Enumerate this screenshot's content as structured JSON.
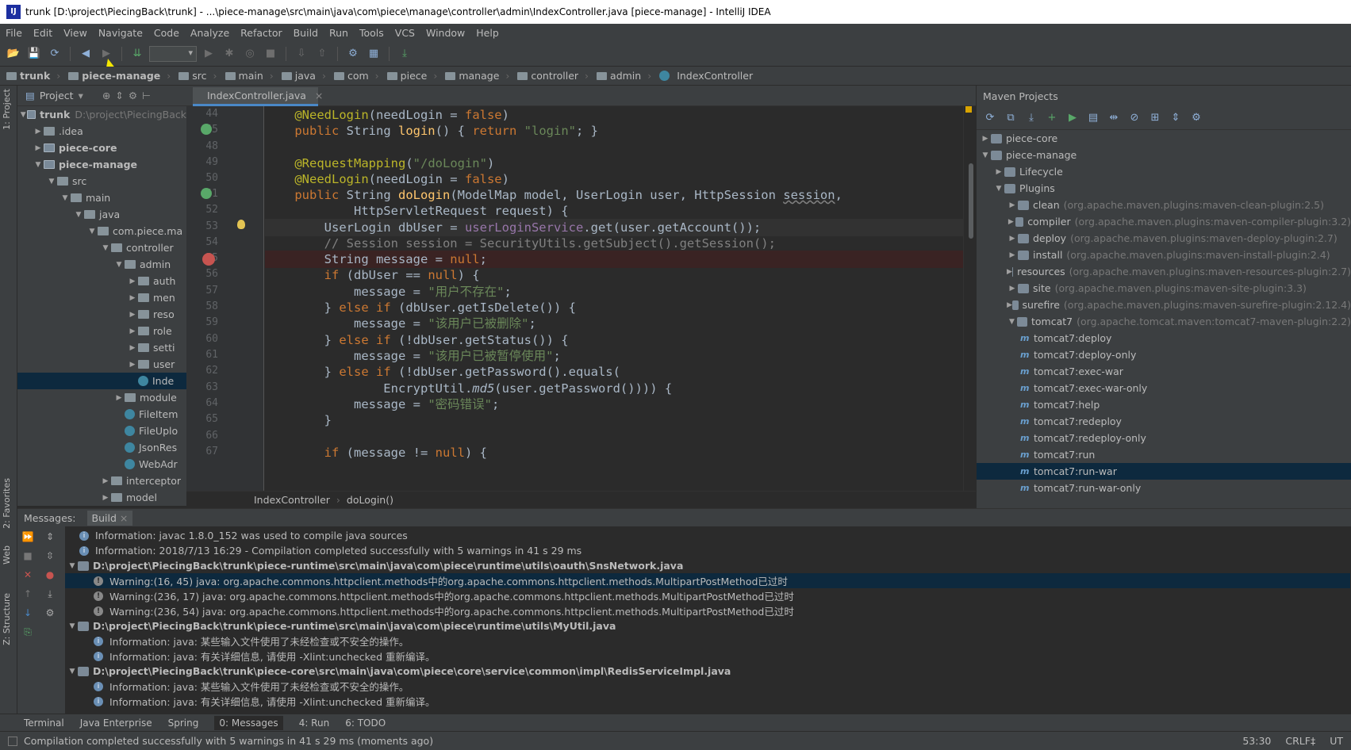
{
  "window": {
    "title": "trunk [D:\\project\\PiecingBack\\trunk] - ...\\piece-manage\\src\\main\\java\\com\\piece\\manage\\controller\\admin\\IndexController.java [piece-manage] - IntelliJ IDEA"
  },
  "menu": [
    "File",
    "Edit",
    "View",
    "Navigate",
    "Code",
    "Analyze",
    "Refactor",
    "Build",
    "Run",
    "Tools",
    "VCS",
    "Window",
    "Help"
  ],
  "breadcrumb": [
    "trunk",
    "piece-manage",
    "src",
    "main",
    "java",
    "com",
    "piece",
    "manage",
    "controller",
    "admin",
    "IndexController"
  ],
  "side_tabs": {
    "project": "1: Project",
    "favorites": "2: Favorites",
    "web": "Web",
    "structure": "Z: Structure"
  },
  "project": {
    "header": "Project",
    "tree": [
      {
        "label": "trunk",
        "extra": "D:\\project\\PiecingBack",
        "depth": 0,
        "open": true,
        "bold": true
      },
      {
        "label": ".idea",
        "depth": 1,
        "open": false
      },
      {
        "label": "piece-core",
        "depth": 1,
        "open": false,
        "bold": true
      },
      {
        "label": "piece-manage",
        "depth": 1,
        "open": true,
        "bold": true
      },
      {
        "label": "src",
        "depth": 2,
        "open": true
      },
      {
        "label": "main",
        "depth": 3,
        "open": true
      },
      {
        "label": "java",
        "depth": 4,
        "open": true
      },
      {
        "label": "com.piece.ma",
        "depth": 5,
        "open": true
      },
      {
        "label": "controller",
        "depth": 6,
        "open": true
      },
      {
        "label": "admin",
        "depth": 7,
        "open": true
      },
      {
        "label": "auth",
        "depth": 8,
        "open": false
      },
      {
        "label": "men",
        "depth": 8,
        "open": false
      },
      {
        "label": "reso",
        "depth": 8,
        "open": false
      },
      {
        "label": "role",
        "depth": 8,
        "open": false
      },
      {
        "label": "setti",
        "depth": 8,
        "open": false
      },
      {
        "label": "user",
        "depth": 8,
        "open": false
      },
      {
        "label": "Inde",
        "depth": 8,
        "cls": true,
        "selected": true
      },
      {
        "label": "module",
        "depth": 7,
        "open": false
      },
      {
        "label": "FileItem",
        "depth": 7,
        "cls": true
      },
      {
        "label": "FileUplo",
        "depth": 7,
        "cls": true
      },
      {
        "label": "JsonRes",
        "depth": 7,
        "cls": true
      },
      {
        "label": "WebAdr",
        "depth": 7,
        "cls": true
      },
      {
        "label": "interceptor",
        "depth": 6,
        "open": false
      },
      {
        "label": "model",
        "depth": 6,
        "open": false
      }
    ]
  },
  "editor": {
    "tab": "IndexController.java",
    "line_numbers": [
      "44",
      "45",
      "48",
      "49",
      "50",
      "51",
      "52",
      "53",
      "54",
      "55",
      "56",
      "57",
      "58",
      "59",
      "60",
      "61",
      "62",
      "63",
      "64",
      "65",
      "66",
      "67"
    ],
    "breadcrumb": [
      "IndexController",
      "doLogin()"
    ]
  },
  "maven": {
    "header": "Maven Projects",
    "rows": [
      {
        "label": "piece-core",
        "depth": 0,
        "open": false
      },
      {
        "label": "piece-manage",
        "depth": 0,
        "open": true
      },
      {
        "label": "Lifecycle",
        "depth": 1,
        "open": false
      },
      {
        "label": "Plugins",
        "depth": 1,
        "open": true
      },
      {
        "label": "clean",
        "extra": "(org.apache.maven.plugins:maven-clean-plugin:2.5)",
        "depth": 2,
        "open": false
      },
      {
        "label": "compiler",
        "extra": "(org.apache.maven.plugins:maven-compiler-plugin:3.2)",
        "depth": 2,
        "open": false
      },
      {
        "label": "deploy",
        "extra": "(org.apache.maven.plugins:maven-deploy-plugin:2.7)",
        "depth": 2,
        "open": false
      },
      {
        "label": "install",
        "extra": "(org.apache.maven.plugins:maven-install-plugin:2.4)",
        "depth": 2,
        "open": false
      },
      {
        "label": "resources",
        "extra": "(org.apache.maven.plugins:maven-resources-plugin:2.7)",
        "depth": 2,
        "open": false
      },
      {
        "label": "site",
        "extra": "(org.apache.maven.plugins:maven-site-plugin:3.3)",
        "depth": 2,
        "open": false
      },
      {
        "label": "surefire",
        "extra": "(org.apache.maven.plugins:maven-surefire-plugin:2.12.4)",
        "depth": 2,
        "open": false
      },
      {
        "label": "tomcat7",
        "extra": "(org.apache.tomcat.maven:tomcat7-maven-plugin:2.2)",
        "depth": 2,
        "open": true
      },
      {
        "label": "tomcat7:deploy",
        "depth": 3,
        "goal": true
      },
      {
        "label": "tomcat7:deploy-only",
        "depth": 3,
        "goal": true
      },
      {
        "label": "tomcat7:exec-war",
        "depth": 3,
        "goal": true
      },
      {
        "label": "tomcat7:exec-war-only",
        "depth": 3,
        "goal": true
      },
      {
        "label": "tomcat7:help",
        "depth": 3,
        "goal": true
      },
      {
        "label": "tomcat7:redeploy",
        "depth": 3,
        "goal": true
      },
      {
        "label": "tomcat7:redeploy-only",
        "depth": 3,
        "goal": true
      },
      {
        "label": "tomcat7:run",
        "depth": 3,
        "goal": true
      },
      {
        "label": "tomcat7:run-war",
        "depth": 3,
        "goal": true,
        "selected": true
      },
      {
        "label": "tomcat7:run-war-only",
        "depth": 3,
        "goal": true
      }
    ]
  },
  "messages": {
    "label": "Messages:",
    "tab": "Build",
    "rows": [
      {
        "kind": "info",
        "indent": 0,
        "text": "Information: javac 1.8.0_152 was used to compile java sources"
      },
      {
        "kind": "info",
        "indent": 0,
        "text": "Information: 2018/7/13 16:29 - Compilation completed successfully with 5 warnings in 41 s 29 ms"
      },
      {
        "kind": "file",
        "indent": 0,
        "text": "D:\\project\\PiecingBack\\trunk\\piece-runtime\\src\\main\\java\\com\\piece\\runtime\\utils\\oauth\\SnsNetwork.java"
      },
      {
        "kind": "warn",
        "indent": 1,
        "text": "Warning:(16, 45)  java: org.apache.commons.httpclient.methods中的org.apache.commons.httpclient.methods.MultipartPostMethod已过时",
        "selected": true
      },
      {
        "kind": "warn",
        "indent": 1,
        "text": "Warning:(236, 17)  java: org.apache.commons.httpclient.methods中的org.apache.commons.httpclient.methods.MultipartPostMethod已过时"
      },
      {
        "kind": "warn",
        "indent": 1,
        "text": "Warning:(236, 54)  java: org.apache.commons.httpclient.methods中的org.apache.commons.httpclient.methods.MultipartPostMethod已过时"
      },
      {
        "kind": "file",
        "indent": 0,
        "text": "D:\\project\\PiecingBack\\trunk\\piece-runtime\\src\\main\\java\\com\\piece\\runtime\\utils\\MyUtil.java"
      },
      {
        "kind": "info",
        "indent": 1,
        "text": "Information: java: 某些输入文件使用了未经检查或不安全的操作。"
      },
      {
        "kind": "info",
        "indent": 1,
        "text": "Information: java: 有关详细信息, 请使用 -Xlint:unchecked 重新编译。"
      },
      {
        "kind": "file",
        "indent": 0,
        "text": "D:\\project\\PiecingBack\\trunk\\piece-core\\src\\main\\java\\com\\piece\\core\\service\\common\\impl\\RedisServiceImpl.java"
      },
      {
        "kind": "info",
        "indent": 1,
        "text": "Information: java: 某些输入文件使用了未经检查或不安全的操作。"
      },
      {
        "kind": "info",
        "indent": 1,
        "text": "Information: java: 有关详细信息, 请使用 -Xlint:unchecked 重新编译。"
      }
    ]
  },
  "tool_tabs": [
    "Terminal",
    "Java Enterprise",
    "Spring",
    "0: Messages",
    "4: Run",
    "6: TODO"
  ],
  "status": {
    "text": "Compilation completed successfully with 5 warnings in 41 s 29 ms (moments ago)",
    "position": "53:30",
    "line_sep": "CRLF‡",
    "encoding": "UT"
  }
}
